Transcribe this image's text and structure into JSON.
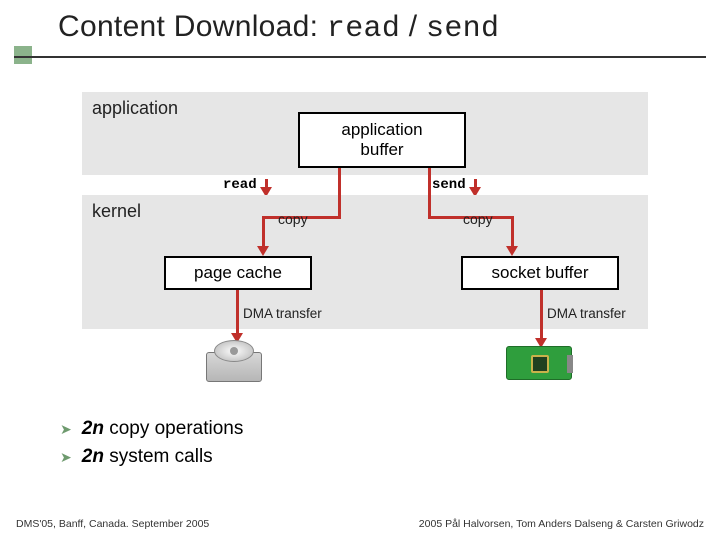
{
  "title": {
    "lead": "Content Download: ",
    "code1": "read",
    "sep": " / ",
    "code2": "send"
  },
  "layers": {
    "application": "application",
    "kernel": "kernel"
  },
  "boxes": {
    "app_buffer_line1": "application",
    "app_buffer_line2": "buffer",
    "page_cache": "page cache",
    "socket_buffer": "socket buffer"
  },
  "arrows": {
    "read": "read",
    "send": "send",
    "copy": "copy",
    "dma": "DMA transfer"
  },
  "bullets": [
    {
      "pre": "2",
      "n": "n",
      "rest": " copy operations"
    },
    {
      "pre": "2",
      "n": "n",
      "rest": " system calls"
    }
  ],
  "footer": {
    "left": "DMS'05, Banff, Canada. September 2005",
    "right": "2005  Pål Halvorsen, Tom Anders Dalseng & Carsten Griwodz"
  }
}
